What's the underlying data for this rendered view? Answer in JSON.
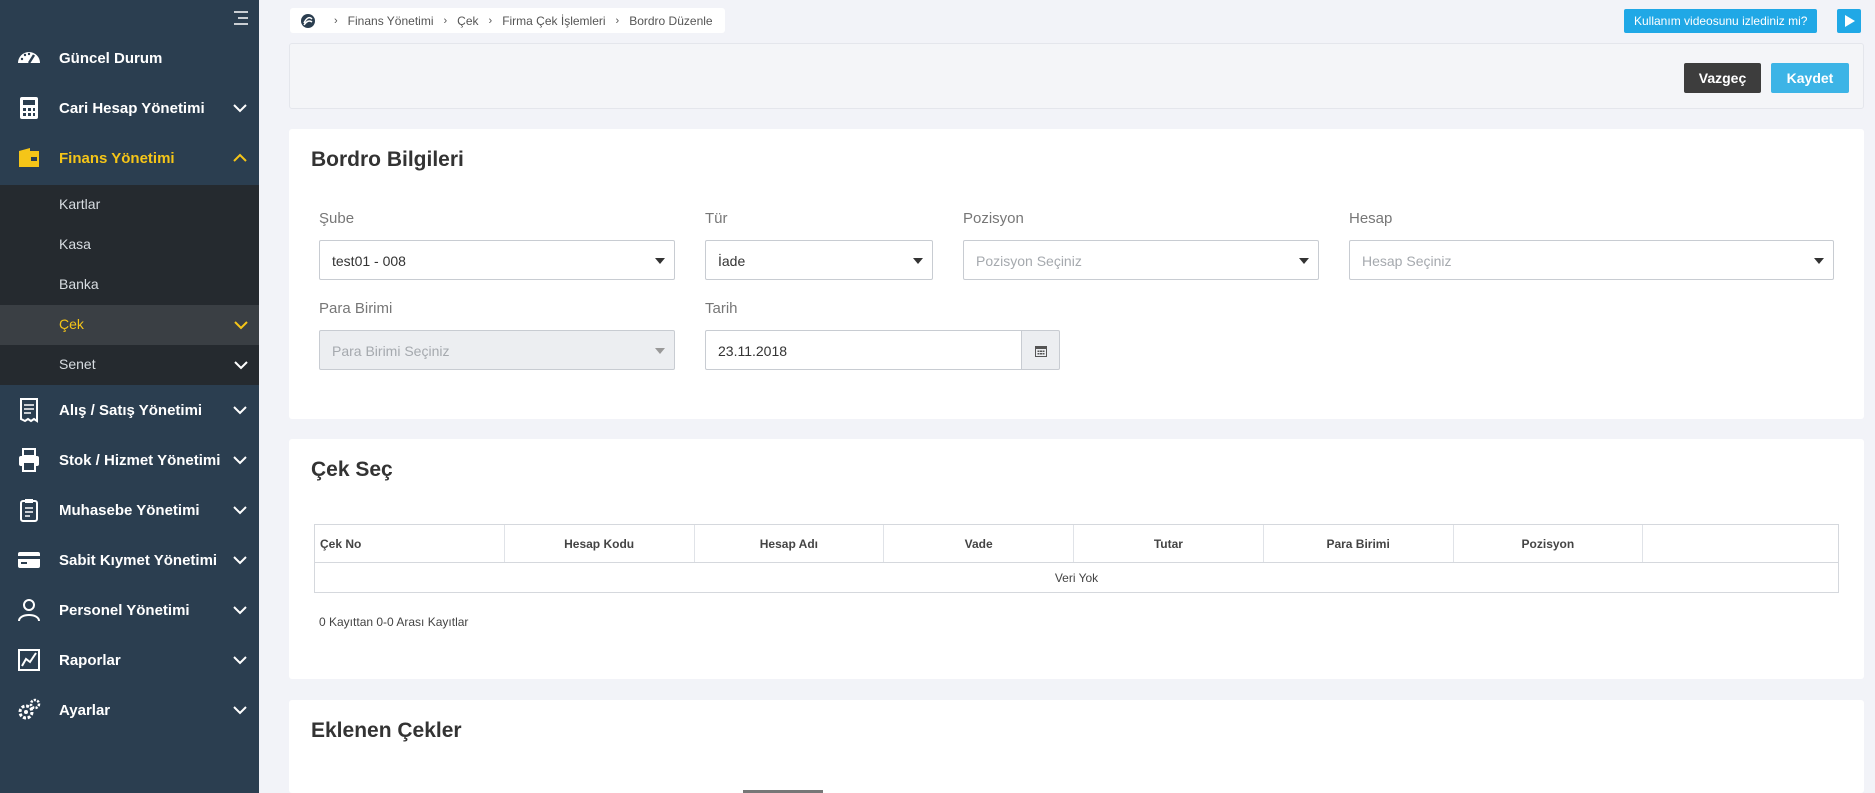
{
  "sidebar": {
    "items": [
      {
        "label": "Güncel Durum"
      },
      {
        "label": "Cari Hesap Yönetimi"
      },
      {
        "label": "Finans Yönetimi"
      },
      {
        "label": "Alış / Satış Yönetimi"
      },
      {
        "label": "Stok / Hizmet Yönetimi"
      },
      {
        "label": "Muhasebe Yönetimi"
      },
      {
        "label": "Sabit Kıymet Yönetimi"
      },
      {
        "label": "Personel Yönetimi"
      },
      {
        "label": "Raporlar"
      },
      {
        "label": "Ayarlar"
      }
    ],
    "sub_items": [
      {
        "label": "Kartlar"
      },
      {
        "label": "Kasa"
      },
      {
        "label": "Banka"
      },
      {
        "label": "Çek"
      },
      {
        "label": "Senet"
      }
    ],
    "active_item": "Finans Yönetimi",
    "active_sub_item": "Çek",
    "accent_color": "#f5c518"
  },
  "breadcrumb": [
    "Finans Yönetimi",
    "Çek",
    "Firma Çek İşlemleri",
    "Bordro Düzenle"
  ],
  "help_label": "Kullanım videosunu izlediniz mi?",
  "actions": {
    "cancel": "Vazgeç",
    "save": "Kaydet"
  },
  "bordro": {
    "title": "Bordro Bilgileri",
    "sube": {
      "label": "Şube",
      "value": "test01 - 008"
    },
    "tur": {
      "label": "Tür",
      "value": "İade"
    },
    "pozisyon": {
      "label": "Pozisyon",
      "placeholder": "Pozisyon Seçiniz"
    },
    "hesap": {
      "label": "Hesap",
      "placeholder": "Hesap Seçiniz"
    },
    "para_birimi": {
      "label": "Para Birimi",
      "placeholder": "Para Birimi Seçiniz"
    },
    "tarih": {
      "label": "Tarih",
      "value": "23.11.2018"
    }
  },
  "cek_sec": {
    "title": "Çek Seç",
    "columns": [
      "Çek No",
      "Hesap Kodu",
      "Hesap Adı",
      "Vade",
      "Tutar",
      "Para Birimi",
      "Pozisyon",
      ""
    ],
    "empty_text": "Veri Yok",
    "info": "0 Kayıttan 0-0 Arası Kayıtlar"
  },
  "eklenen": {
    "title": "Eklenen Çekler"
  },
  "colors": {
    "sidebar_bg": "#2b3e50",
    "primary": "#3cb4e6",
    "dark_button": "#3d3d3d"
  }
}
